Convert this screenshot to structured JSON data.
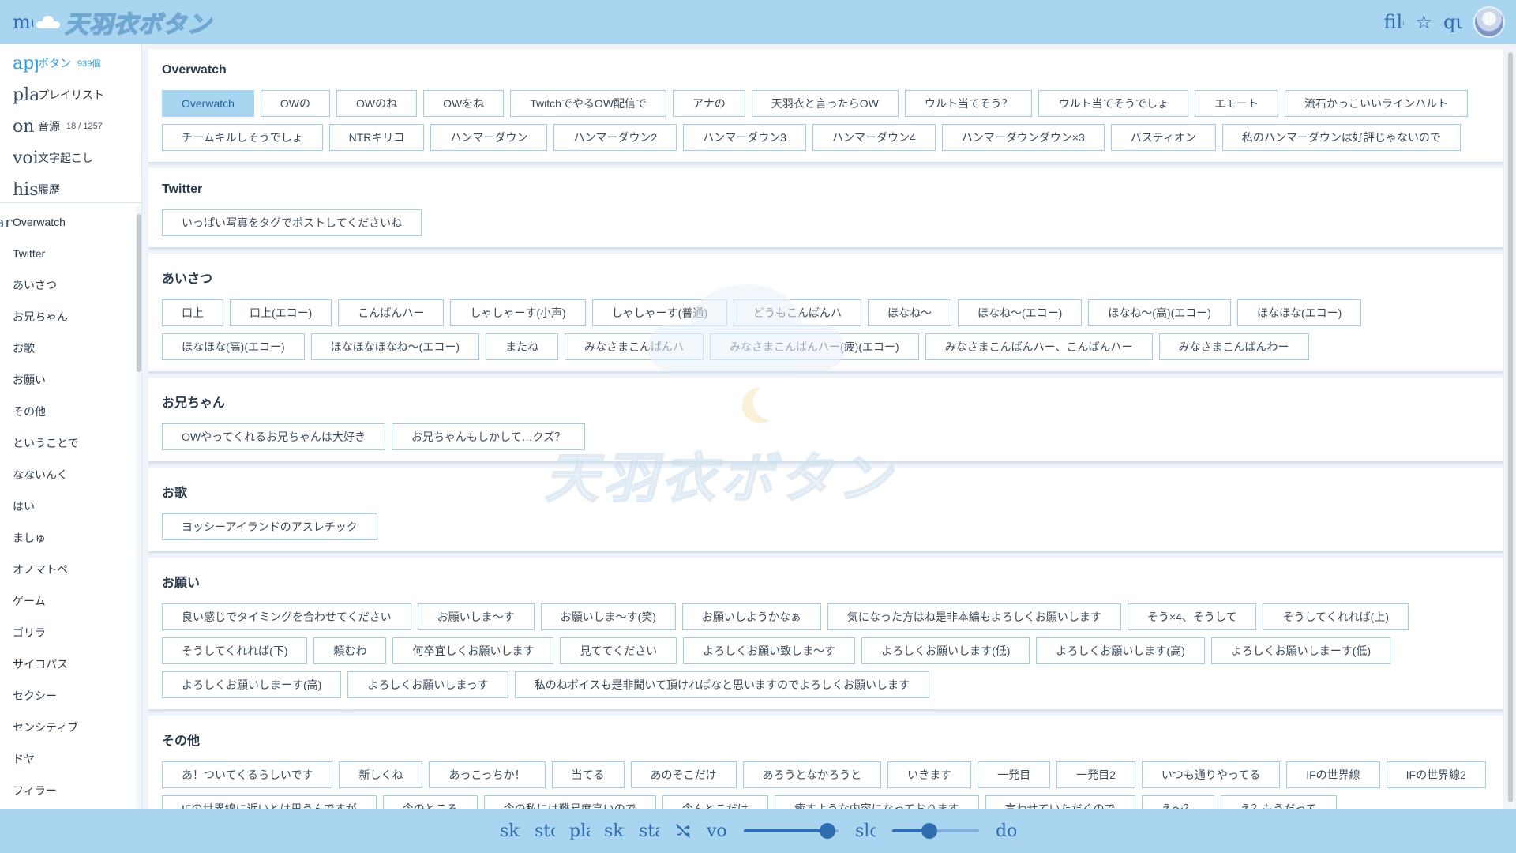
{
  "header": {
    "menu_glyph": "menu",
    "logo_text": "天羽衣ボタン",
    "file_glyph": "file",
    "star_glyph": "☆",
    "search_glyph": "quiz"
  },
  "nav": [
    {
      "icon": "app",
      "label": "ボタン",
      "count": "939個",
      "active": true
    },
    {
      "icon": "playlist",
      "label": "プレイリスト",
      "count": "",
      "active": false
    },
    {
      "icon": "on",
      "label": "音源",
      "count": "18 / 1257",
      "active": false
    },
    {
      "icon": "voice",
      "label": "文字起こし",
      "count": "",
      "active": false
    },
    {
      "icon": "history",
      "label": "履歴",
      "count": "",
      "active": false
    }
  ],
  "category_prefix": "ar",
  "categories": [
    "Overwatch",
    "Twitter",
    "あいさつ",
    "お兄ちゃん",
    "お歌",
    "お願い",
    "その他",
    "ということで",
    "なないんく",
    "はい",
    "ましゅ",
    "オノマトペ",
    "ゲーム",
    "ゴリラ",
    "サイコパス",
    "セクシー",
    "センシティブ",
    "ドヤ",
    "フィラー"
  ],
  "sections": [
    {
      "title": "Overwatch",
      "buttons": [
        "Overwatch",
        "OWの",
        "OWのね",
        "OWをね",
        "TwitchでやるOW配信で",
        "アナの",
        "天羽衣と言ったらOW",
        "ウルト当てそう？",
        "ウルト当てそうでしょ",
        "エモート",
        "流石かっこいいラインハルト",
        "チームキルしそうでしょ",
        "NTRキリコ",
        "ハンマーダウン",
        "ハンマーダウン2",
        "ハンマーダウン3",
        "ハンマーダウン4",
        "ハンマーダウンダウン×3",
        "バスティオン",
        "私のハンマーダウンは好評じゃないので"
      ]
    },
    {
      "title": "Twitter",
      "buttons": [
        "いっぱい写真をタグでポストしてくださいね"
      ]
    },
    {
      "title": "あいさつ",
      "buttons": [
        "口上",
        "口上(エコー)",
        "こんばんハー",
        "しゃしゃーす(小声)",
        "しゃしゃーす(普通)",
        "どうもこんばんハ",
        "ほなね～",
        "ほなね～(エコー)",
        "ほなね～(高)(エコー)",
        "ほなほな(エコー)",
        "ほなほな(高)(エコー)",
        "ほなほなほなね～(エコー)",
        "またね",
        "みなさまこんばんハ",
        "みなさまこんばんハー(疲)(エコー)",
        "みなさまこんばんハー、こんばんハー",
        "みなさまこんばんわー"
      ]
    },
    {
      "title": "お兄ちゃん",
      "buttons": [
        "OWやってくれるお兄ちゃんは大好き",
        "お兄ちゃんもしかして…クズ？"
      ]
    },
    {
      "title": "お歌",
      "buttons": [
        "ヨッシーアイランドのアスレチック"
      ]
    },
    {
      "title": "お願い",
      "buttons": [
        "良い感じでタイミングを合わせてください",
        "お願いしま～す",
        "お願いしま～す(笑)",
        "お願いしようかなぁ",
        "気になった方はね是非本編もよろしくお願いします",
        "そう×4、そうして",
        "そうしてくれれば(上)",
        "そうしてくれれば(下)",
        "頼むわ",
        "何卒宜しくお願いします",
        "見ててください",
        "よろしくお願い致しま〜す",
        "よろしくお願いします(低)",
        "よろしくお願いします(高)",
        "よろしくお願いしまーす(低)",
        "よろしくお願いしまーす(高)",
        "よろしくお願いしまっす",
        "私のねボイスも是非聞いて頂ければなと思いますのでよろしくお願いします"
      ]
    },
    {
      "title": "その他",
      "buttons": [
        "あ！ついてくるらしいです",
        "新しくね",
        "あっこっちか！",
        "当てる",
        "あのそこだけ",
        "あろうとなかろうと",
        "いきます",
        "一発目",
        "一発目2",
        "いつも通りやってる",
        "IFの世界線",
        "IFの世界線2",
        "IFの世界線に近いとは思うんですが",
        "今のところ",
        "今の私には難易度高いので",
        "今んとこだけ",
        "癒すような内容になっております",
        "言わせていただくので",
        "え～？",
        "え？もうだって"
      ]
    }
  ],
  "watermark_text": "天羽衣ボタン",
  "player": {
    "skip_back_glyph": "skip",
    "stop_glyph": "stop",
    "play_glyph": "play",
    "skip_fwd_glyph": "skip",
    "star_glyph": "star",
    "volume_glyph": "volume",
    "slow_glyph": "slow",
    "download_glyph": "download",
    "volume_level": 0.88,
    "speed_level": 0.43
  },
  "colors": {
    "accent": "#a9d5f0",
    "brand": "#2f6cb0",
    "active_text": "#2f9fd8"
  }
}
